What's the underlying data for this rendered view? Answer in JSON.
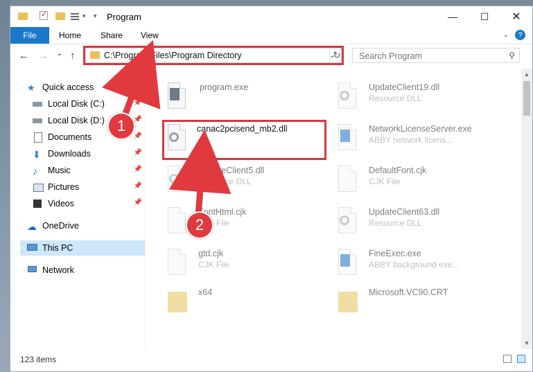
{
  "window": {
    "title": "Program"
  },
  "ribbon": {
    "file_tab": "File",
    "tabs": [
      "Home",
      "Share",
      "View"
    ],
    "help": "?"
  },
  "nav": {
    "back": "←",
    "forward": "→",
    "recent": "⌄",
    "up": "↑",
    "address": "C:\\Program Files\\Program Directory",
    "search_placeholder": "Search Program"
  },
  "sidebar": {
    "items": [
      {
        "label": "Quick access"
      },
      {
        "label": "Local Disk (C:)"
      },
      {
        "label": "Local Disk (D:)"
      },
      {
        "label": "Documents"
      },
      {
        "label": "Downloads"
      },
      {
        "label": "Music"
      },
      {
        "label": "Pictures"
      },
      {
        "label": "Videos"
      },
      {
        "label": "OneDrive"
      },
      {
        "label": "This PC"
      },
      {
        "label": "Network"
      }
    ]
  },
  "files": {
    "left": [
      {
        "name": "program.exe",
        "type": ""
      },
      {
        "name": "canac2pcisend_mb2.dll",
        "type": ""
      },
      {
        "name": "UpdateClient5.dll",
        "type": "Resource DLL"
      },
      {
        "name": "FontHtml.cjk",
        "type": "CJK File"
      },
      {
        "name": "gtd.cjk",
        "type": "CJK File"
      },
      {
        "name": "x64",
        "type": ""
      }
    ],
    "right": [
      {
        "name": "UpdateClient19.dll",
        "type": "Resource DLL"
      },
      {
        "name": "NetworkLicenseServer.exe",
        "type": "ABBY network licens..."
      },
      {
        "name": "DefaultFont.cjk",
        "type": "CJK File"
      },
      {
        "name": "UpdateClient63.dll",
        "type": "Resource DLL"
      },
      {
        "name": "FineExec.exe",
        "type": "ABBY background exe..."
      },
      {
        "name": "Microsoft.VC90.CRT",
        "type": ""
      }
    ]
  },
  "status": {
    "items": "123 items"
  },
  "annotations": {
    "step1": "1",
    "step2": "2"
  },
  "colors": {
    "accent": "#1979ca",
    "annotation": "#d7383d",
    "selection": "#cce8ff",
    "folder": "#e8c25b"
  }
}
